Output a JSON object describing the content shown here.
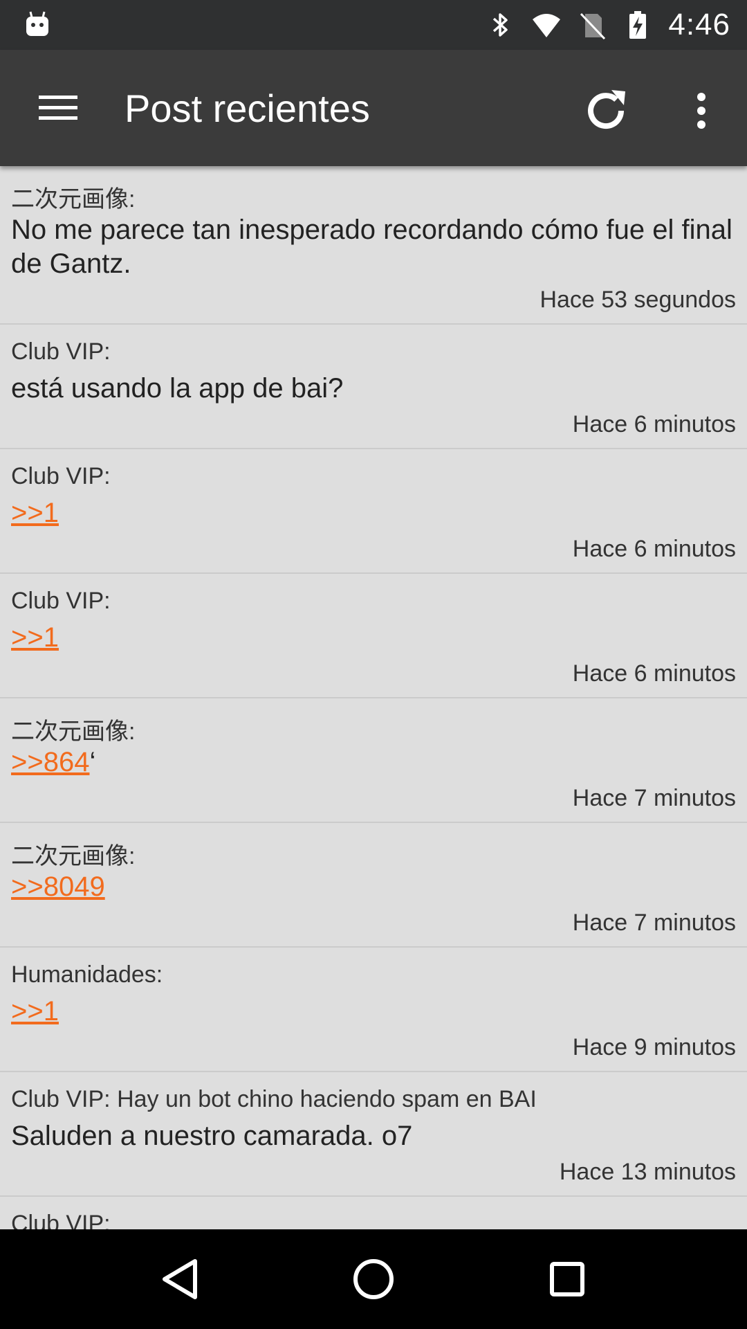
{
  "status_bar": {
    "time": "4:46",
    "icons": [
      "android-debug-icon",
      "bluetooth-icon",
      "wifi-icon",
      "no-sim-icon",
      "battery-charging-icon"
    ]
  },
  "app_bar": {
    "title": "Post recientes",
    "icons": [
      "hamburger-menu-icon",
      "refresh-icon",
      "overflow-menu-icon"
    ]
  },
  "colors": {
    "status_bar": "#2f3031",
    "app_bar": "#3b3b3b",
    "background": "#dedede",
    "link": "#f26b1d",
    "nav_bar": "#000000"
  },
  "posts": [
    {
      "board": "二次元画像:",
      "body_text": "No me parece tan inesperado recordando cómo fue el final de Gantz.",
      "link": "",
      "suffix": "",
      "time": "Hace 53 segundos"
    },
    {
      "board": "Club VIP:",
      "body_text": "está usando la app de bai?",
      "link": "",
      "suffix": "",
      "time": "Hace 6 minutos"
    },
    {
      "board": "Club VIP:",
      "body_text": "",
      "link": ">>1",
      "suffix": "",
      "time": "Hace 6 minutos"
    },
    {
      "board": "Club VIP:",
      "body_text": "",
      "link": ">>1",
      "suffix": "",
      "time": "Hace 6 minutos"
    },
    {
      "board": "二次元画像:",
      "body_text": "",
      "link": ">>864",
      "suffix": "‘",
      "time": "Hace 7 minutos"
    },
    {
      "board": "二次元画像:",
      "body_text": "",
      "link": ">>8049",
      "suffix": "",
      "time": "Hace 7 minutos"
    },
    {
      "board": "Humanidades:",
      "body_text": "",
      "link": ">>1",
      "suffix": "",
      "time": "Hace 9 minutos"
    },
    {
      "board": "Club VIP: Hay un bot chino haciendo spam en BAI",
      "body_text": "Saluden a nuestro camarada. o7",
      "link": "",
      "suffix": "",
      "time": "Hace 13 minutos"
    },
    {
      "board": "Club VIP:",
      "body_text": "",
      "link": "",
      "suffix": "",
      "time": ""
    }
  ],
  "nav_bar": {
    "icons": [
      "back-icon",
      "home-icon",
      "recents-icon"
    ]
  }
}
